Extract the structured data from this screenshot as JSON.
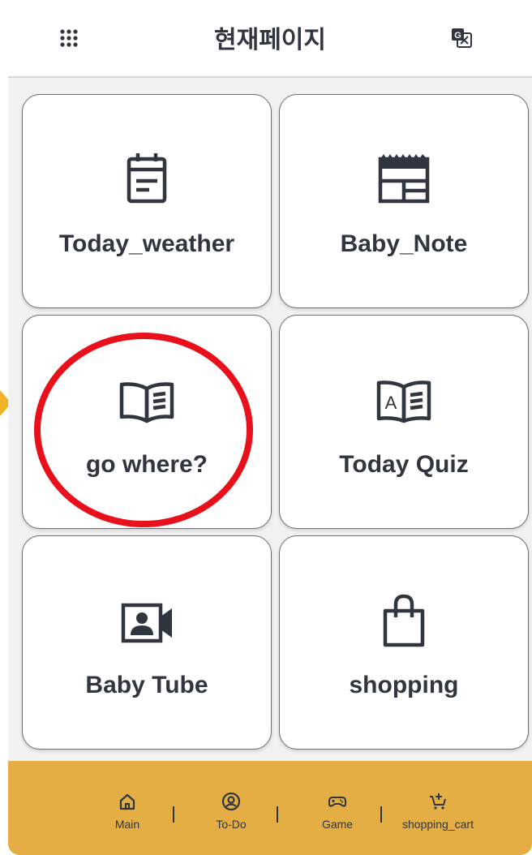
{
  "header": {
    "title": "현재페이지",
    "menu_icon": "grid-dots-icon",
    "translate_icon": "translate-icon"
  },
  "tiles": [
    {
      "label": "Today_weather",
      "icon": "calendar-note-icon"
    },
    {
      "label": "Baby_Note",
      "icon": "layout-template-icon"
    },
    {
      "label": "go where?",
      "icon": "open-book-icon"
    },
    {
      "label": "Today Quiz",
      "icon": "book-a-icon"
    },
    {
      "label": "Baby Tube",
      "icon": "video-contact-icon"
    },
    {
      "label": "shopping",
      "icon": "shopping-bag-icon"
    }
  ],
  "bottom_nav": [
    {
      "label": "Main",
      "icon": "home-icon"
    },
    {
      "label": "To-Do",
      "icon": "user-circle-icon"
    },
    {
      "label": "Game",
      "icon": "gamepad-icon"
    },
    {
      "label": "shopping_cart",
      "icon": "cart-add-icon"
    }
  ],
  "colors": {
    "accent": "#e4ae44",
    "highlight_circle": "#e8101a",
    "text": "#2f3640",
    "background": "#f2f2f2"
  }
}
